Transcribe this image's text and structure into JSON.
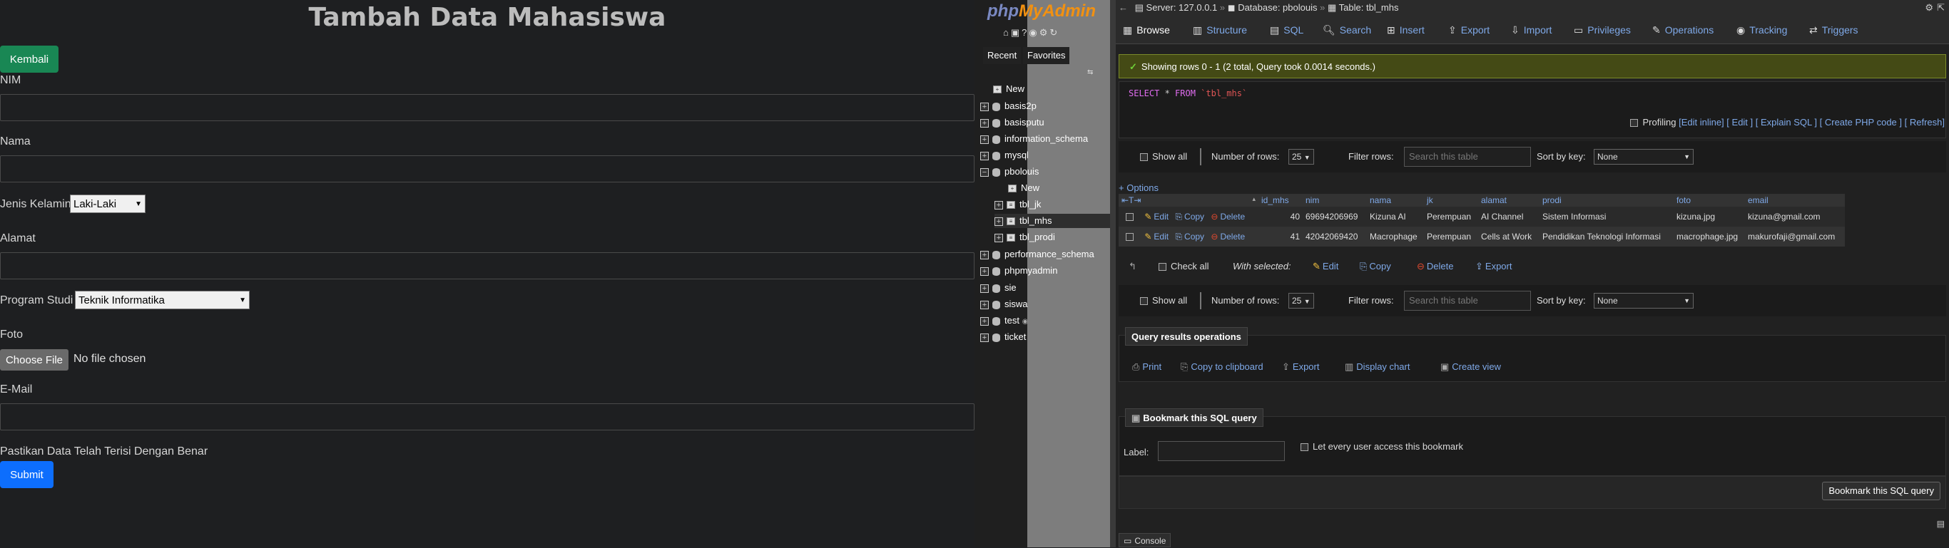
{
  "form": {
    "title": "Tambah Data Mahasiswa",
    "back_button": "Kembali",
    "nim_label": "NIM",
    "nama_label": "Nama",
    "gender_label": "Jenis Kelamin",
    "gender_value": "Laki-Laki",
    "alamat_label": "Alamat",
    "prodi_label": "Program Studi",
    "prodi_value": "Teknik Informatika",
    "foto_label": "Foto",
    "file_button": "Choose File",
    "file_status": "No file chosen",
    "email_label": "E-Mail",
    "confirm_text": "Pastikan Data Telah Terisi Dengan Benar",
    "submit_button": "Submit"
  },
  "pma_nav": {
    "logo_php": "php",
    "logo_my": "MyAdmin",
    "tab_recent": "Recent",
    "tab_favorites": "Favorites",
    "tree": [
      {
        "label": "New"
      },
      {
        "label": "basis2p"
      },
      {
        "label": "basisputu"
      },
      {
        "label": "information_schema"
      },
      {
        "label": "mysql"
      },
      {
        "label": "pbolouis"
      },
      {
        "label": "New"
      },
      {
        "label": "tbl_jk"
      },
      {
        "label": "tbl_mhs"
      },
      {
        "label": "tbl_prodi"
      },
      {
        "label": "performance_schema"
      },
      {
        "label": "phpmyadmin"
      },
      {
        "label": "sie"
      },
      {
        "label": "siswa"
      },
      {
        "label": "test"
      },
      {
        "label": "ticket"
      }
    ]
  },
  "pma_main": {
    "breadcrumb": {
      "server": "Server: 127.0.0.1",
      "database": "Database: pbolouis",
      "table": "Table: tbl_mhs"
    },
    "tabs": [
      "Browse",
      "Structure",
      "SQL",
      "Search",
      "Insert",
      "Export",
      "Import",
      "Privileges",
      "Operations",
      "Tracking",
      "Triggers"
    ],
    "success_message": "Showing rows 0 - 1 (2 total, Query took 0.0014 seconds.)",
    "sql_kw1": "SELECT",
    "sql_mid": " * ",
    "sql_kw2": "FROM",
    "sql_str": " `tbl_mhs`",
    "profiling": {
      "label": "Profiling",
      "edit_inline": "[Edit inline]",
      "edit": "[ Edit ]",
      "explain": "[ Explain SQL ]",
      "create_php": "[ Create PHP code ]",
      "refresh": "[ Refresh]"
    },
    "nav_controls": {
      "show_all": "Show all",
      "number_of_rows_label": "Number of rows:",
      "rows_value": "25",
      "filter_label": "Filter rows:",
      "filter_placeholder": "Search this table",
      "sort_label": "Sort by key:",
      "sort_value": "None"
    },
    "options_link": "+ Options",
    "columns": [
      "id_mhs",
      "nim",
      "nama",
      "jk",
      "alamat",
      "prodi",
      "foto",
      "email"
    ],
    "row_actions": {
      "edit": "Edit",
      "copy": "Copy",
      "delete": "Delete"
    },
    "rows": [
      {
        "id_mhs": "40",
        "nim": "69694206969",
        "nama": "Kizuna AI",
        "jk": "Perempuan",
        "alamat": "AI Channel",
        "prodi": "Sistem Informasi",
        "foto": "kizuna.jpg",
        "email": "kizuna@gmail.com"
      },
      {
        "id_mhs": "41",
        "nim": "42042069420",
        "nama": "Macrophage",
        "jk": "Perempuan",
        "alamat": "Cells at Work",
        "prodi": "Pendidikan Teknologi Informasi",
        "foto": "macrophage.jpg",
        "email": "makurofaji@gmail.com"
      }
    ],
    "bulk": {
      "check_all": "Check all",
      "with_selected": "With selected:",
      "edit": "Edit",
      "copy": "Copy",
      "delete": "Delete",
      "export": "Export"
    },
    "query_ops": {
      "legend": "Query results operations",
      "print": "Print",
      "copy_clipboard": "Copy to clipboard",
      "export": "Export",
      "display_chart": "Display chart",
      "create_view": "Create view"
    },
    "bookmark": {
      "legend": "Bookmark this SQL query",
      "label": "Label:",
      "public_label": "Let every user access this bookmark",
      "button": "Bookmark this SQL query"
    },
    "console": "Console"
  }
}
